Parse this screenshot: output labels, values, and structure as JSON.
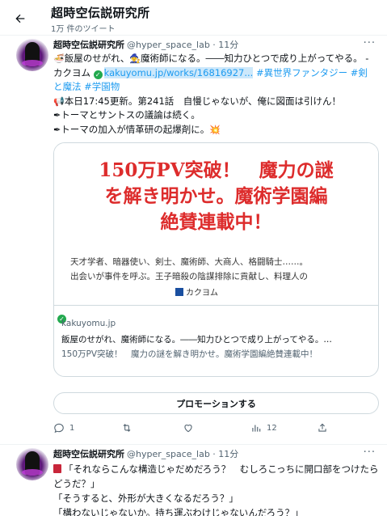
{
  "header": {
    "title": "超時空伝説研究所",
    "subtitle": "1万 件のツイート"
  },
  "tweet1": {
    "name": "超時空伝説研究所",
    "meta": "@hyper_space_lab · 11分",
    "line1_a": "飯屋のせがれ、",
    "line1_b": "魔術師になる。――知力ひとつで成り上がってやる。 - カクヨム",
    "url": "kakuyomu.jp/works/16816927...",
    "hashtag1": "#異世界ファンタジー",
    "hashtag2": "#剣と魔法",
    "hashtag3": "#学園物",
    "line3": "本日17:45更新。第241話　自慢じゃないが、俺に図面は引けん！",
    "line4": "トーマとサントスの議論は続く。",
    "line5": "トーマの加入が情革研の起爆剤に。",
    "card": {
      "headline1": "150万PV突破！　魔力の謎",
      "headline2": "を解き明かせ。魔術学園編",
      "headline3": "絶賛連載中！",
      "desc1": "天才学者、暗器使い、剣士、魔術師、大商人、格闘騎士……。",
      "desc2": "出会いが事件を呼ぶ。王子暗殺の陰謀排除に貢献し、料理人の",
      "logo": "カクヨム",
      "domain": "kakuyomu.jp",
      "title": "飯屋のせがれ、魔術師になる。――知力ひとつで成り上がってやる。…",
      "summary": "150万PV突破！　魔力の謎を解き明かせ。魔術学園編絶賛連載中！"
    },
    "promote_label": "プロモーションする",
    "actions": {
      "reply_count": "1",
      "retweet_count": "",
      "like_count": "",
      "views_count": "12"
    }
  },
  "tweet2": {
    "name": "超時空伝説研究所",
    "meta": "@hyper_space_lab · 11分",
    "line1": "「それならこんな構造じゃだめだろう？　むしろこっちに開口部をつけたらどうだ？」",
    "line2": "「そうすると、外形が大きくなるだろう？」",
    "line3": "「構わないじゃないか。持ち運ぶわけじゃないんだろう？」"
  },
  "colors": {
    "link": "#1d9bf0",
    "headline_red": "#dd2c2c",
    "verify_green": "#23a94f",
    "muted": "#536471"
  },
  "icons": [
    "back-arrow-icon",
    "more-icon",
    "reply-icon",
    "retweet-icon",
    "like-icon",
    "views-icon",
    "share-icon",
    "verified-check-icon",
    "kakuyomu-logo-icon"
  ]
}
